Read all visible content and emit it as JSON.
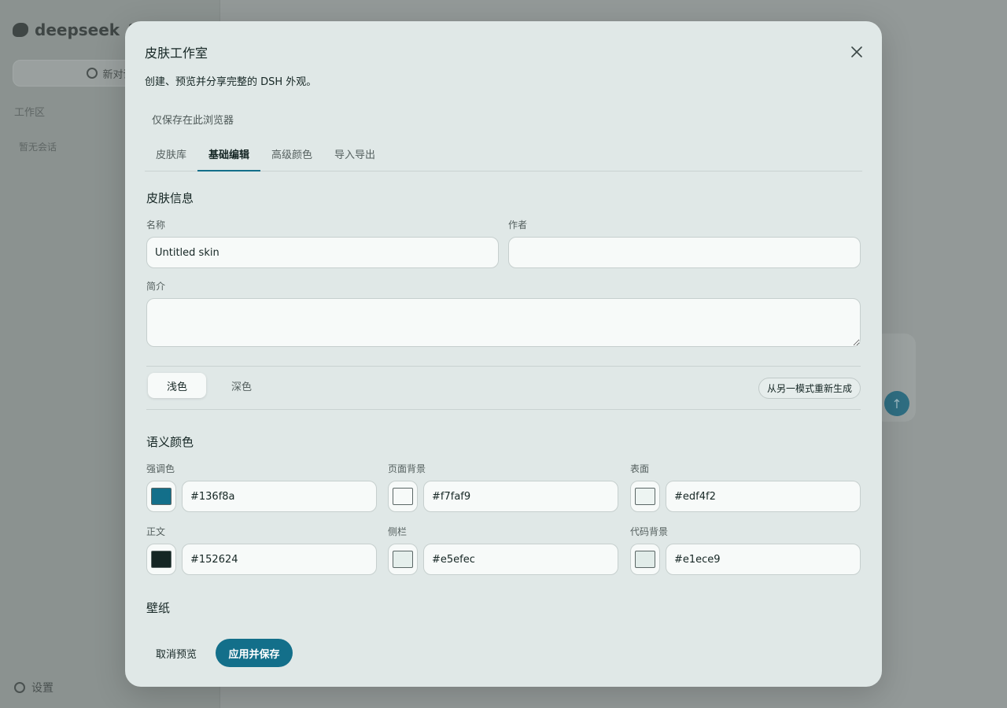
{
  "background": {
    "brand": "deepseek",
    "new_chat": "新对话",
    "section": "工作区",
    "item": "暂无会话",
    "settings": "设置",
    "send_icon": "arrow-up-icon"
  },
  "modal": {
    "title": "皮肤工作室",
    "description": "创建、预览并分享完整的 DSH 外观。",
    "storage_note": "仅保存在此浏览器",
    "close_icon": "close-icon",
    "tabs": [
      {
        "label": "皮肤库",
        "active": false
      },
      {
        "label": "基础编辑",
        "active": true
      },
      {
        "label": "高级颜色",
        "active": false
      },
      {
        "label": "导入导出",
        "active": false
      }
    ]
  },
  "skin_info": {
    "title": "皮肤信息",
    "name_label": "名称",
    "name_value": "Untitled skin",
    "author_label": "作者",
    "author_value": "",
    "desc_label": "简介",
    "desc_value": ""
  },
  "mode": {
    "light": "浅色",
    "dark": "深色",
    "active": "light",
    "regenerate": "从另一模式重新生成"
  },
  "semantic": {
    "title": "语义颜色",
    "colors": [
      {
        "label": "强调色",
        "value": "#136f8a",
        "swatch": "#136f8a"
      },
      {
        "label": "页面背景",
        "value": "#f7faf9",
        "swatch": "#f7faf9"
      },
      {
        "label": "表面",
        "value": "#edf4f2",
        "swatch": "#edf4f2"
      },
      {
        "label": "正文",
        "value": "#152624",
        "swatch": "#152624"
      },
      {
        "label": "侧栏",
        "value": "#e5efec",
        "swatch": "#e5efec"
      },
      {
        "label": "代码背景",
        "value": "#e1ece9",
        "swatch": "#e1ece9"
      }
    ]
  },
  "wallpaper": {
    "title": "壁纸"
  },
  "footer": {
    "cancel": "取消预览",
    "apply": "应用并保存"
  },
  "colors": {
    "accent": "#136f8a",
    "modal_bg": "#e0e8e7",
    "input_bg": "#f7faf9"
  }
}
